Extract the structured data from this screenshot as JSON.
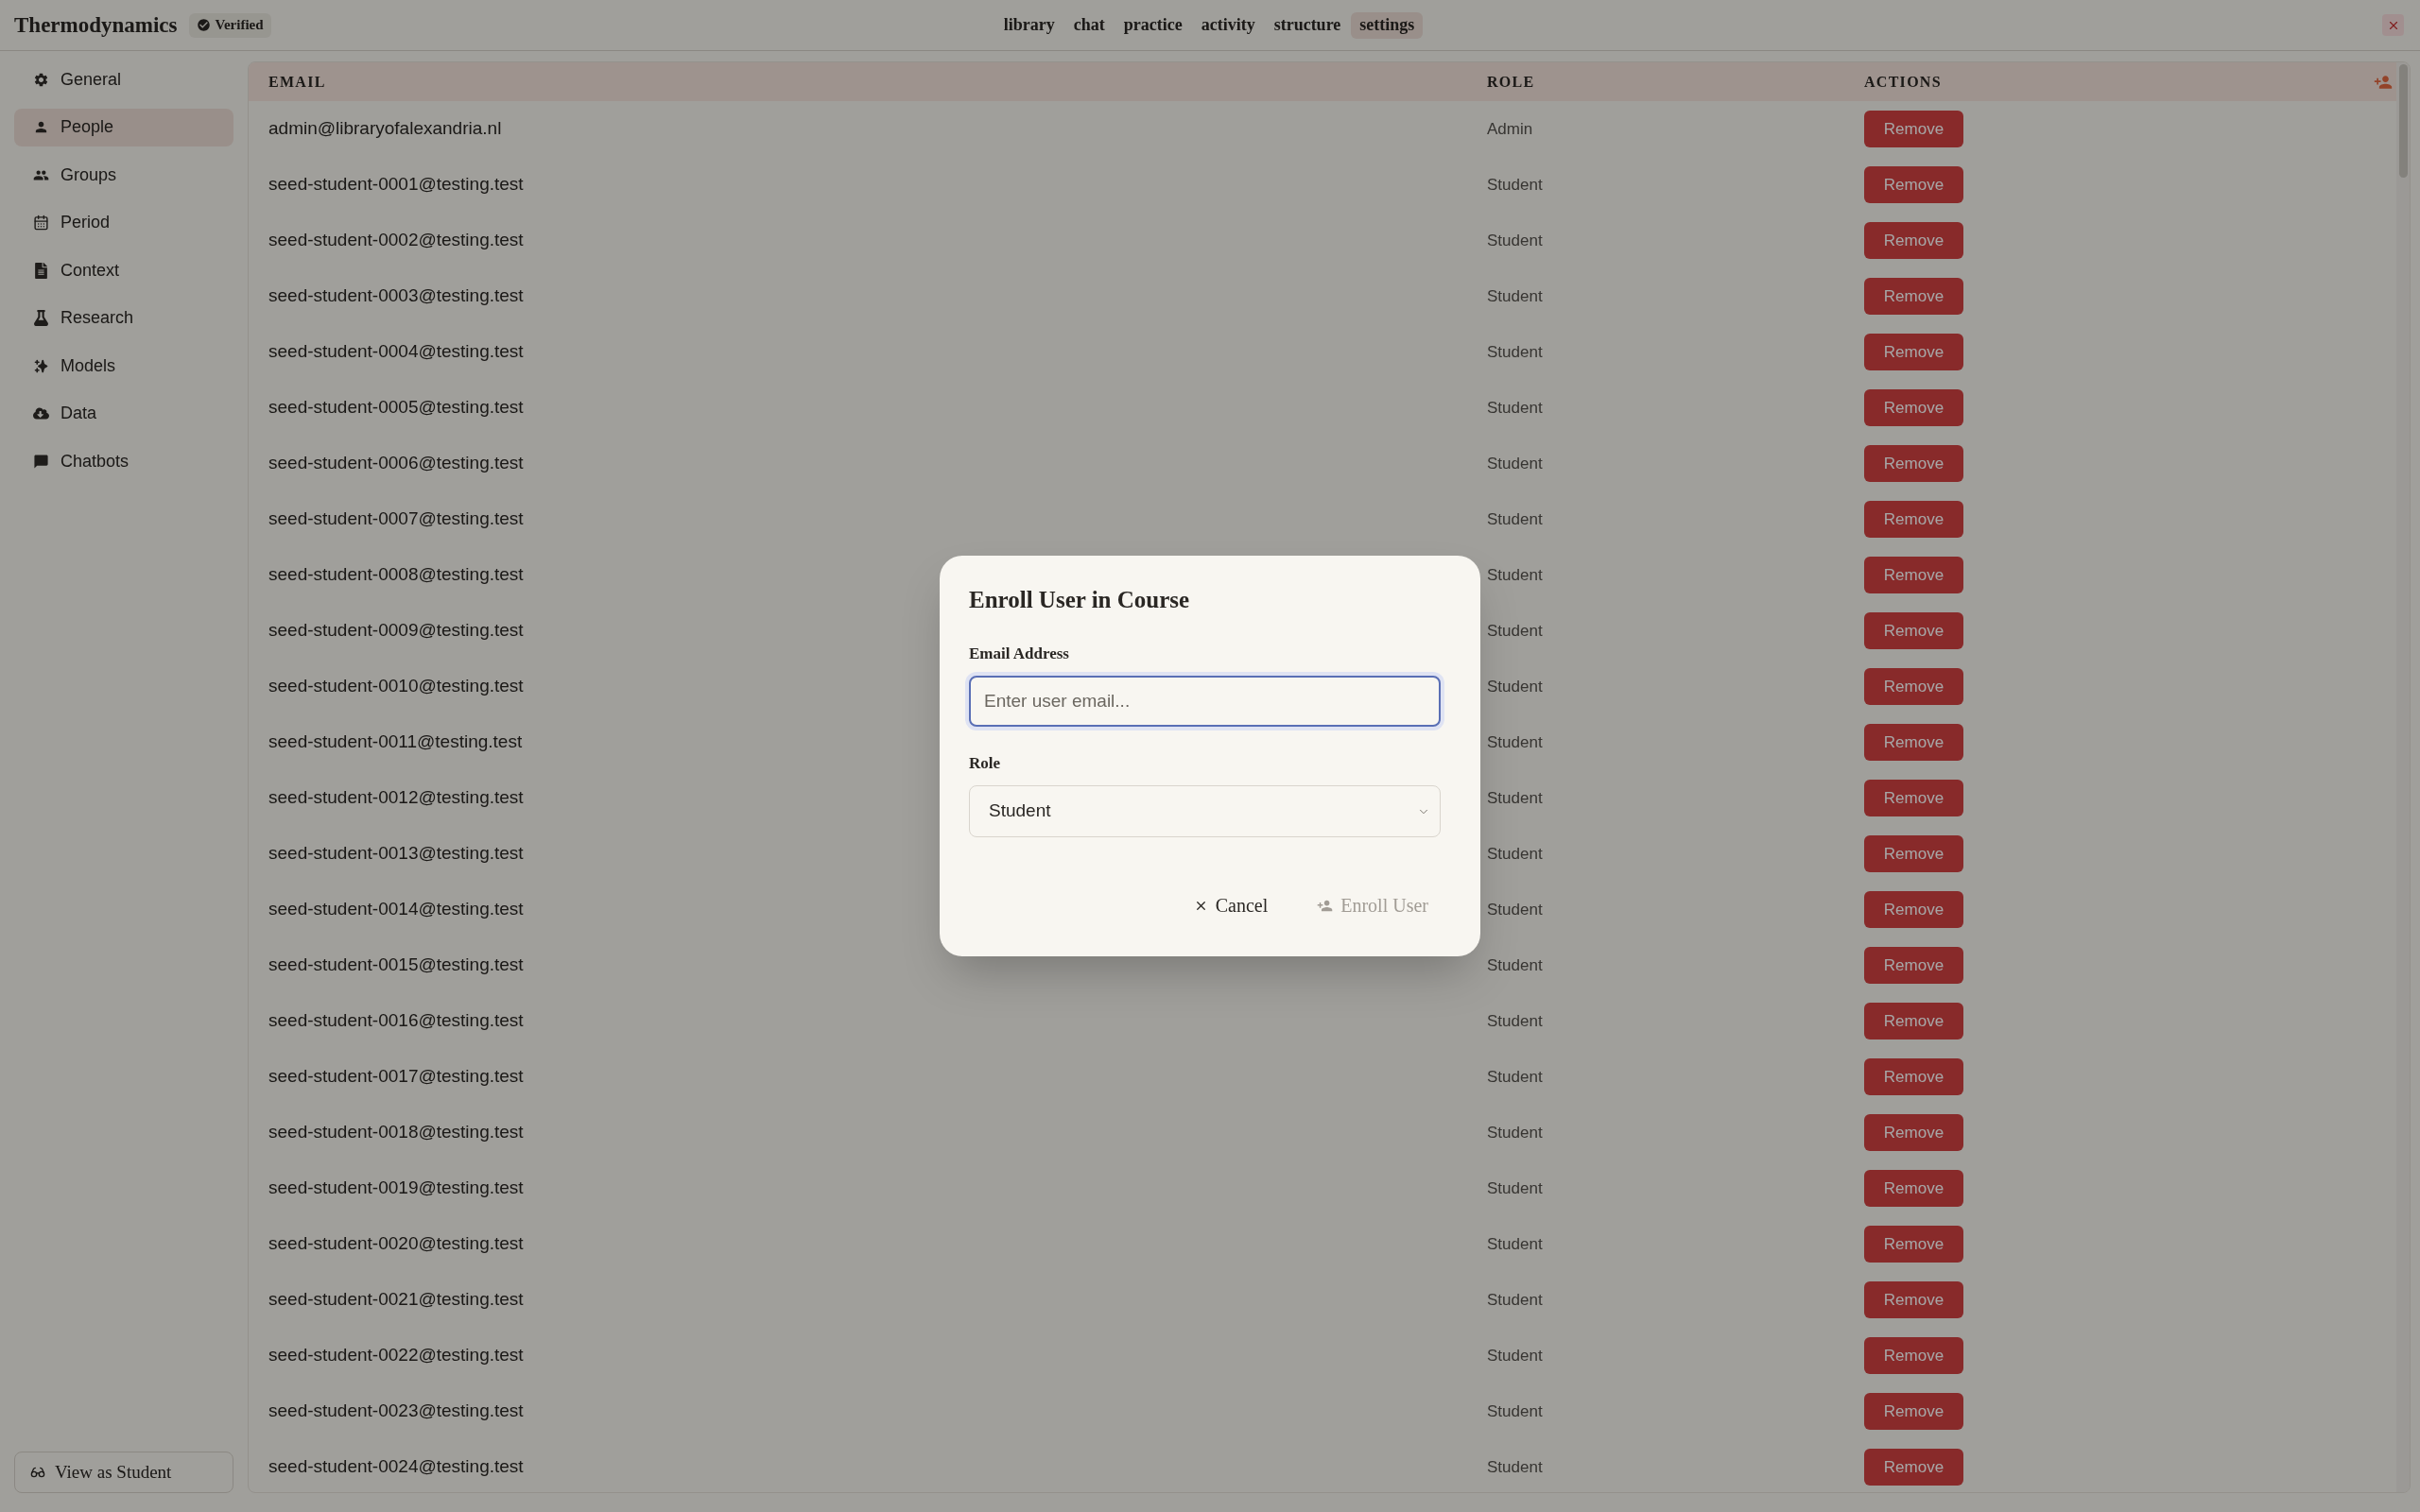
{
  "app_bar": {
    "title": "Thermodynamics",
    "badge": {
      "label": "Verified"
    },
    "nav_tabs": [
      {
        "label": "library",
        "selected": false
      },
      {
        "label": "chat",
        "selected": false
      },
      {
        "label": "practice",
        "selected": false
      },
      {
        "label": "activity",
        "selected": false
      },
      {
        "label": "structure",
        "selected": false
      },
      {
        "label": "settings",
        "selected": true
      }
    ]
  },
  "sidebar": {
    "items": [
      {
        "label": "General",
        "selected": false
      },
      {
        "label": "People",
        "selected": true
      },
      {
        "label": "Groups",
        "selected": false
      },
      {
        "label": "Period",
        "selected": false
      },
      {
        "label": "Context",
        "selected": false
      },
      {
        "label": "Research",
        "selected": false
      },
      {
        "label": "Models",
        "selected": false
      },
      {
        "label": "Data",
        "selected": false
      },
      {
        "label": "Chatbots",
        "selected": false
      }
    ],
    "footer_button": {
      "label": "View as Student"
    }
  },
  "table": {
    "columns": [
      "EMAIL",
      "ROLE",
      "ACTIONS"
    ],
    "rows": [
      {
        "email": "admin@libraryofalexandria.nl",
        "role": "Admin",
        "action": "Remove"
      },
      {
        "email": "seed-student-0001@testing.test",
        "role": "Student",
        "action": "Remove"
      },
      {
        "email": "seed-student-0002@testing.test",
        "role": "Student",
        "action": "Remove"
      },
      {
        "email": "seed-student-0003@testing.test",
        "role": "Student",
        "action": "Remove"
      },
      {
        "email": "seed-student-0004@testing.test",
        "role": "Student",
        "action": "Remove"
      },
      {
        "email": "seed-student-0005@testing.test",
        "role": "Student",
        "action": "Remove"
      },
      {
        "email": "seed-student-0006@testing.test",
        "role": "Student",
        "action": "Remove"
      },
      {
        "email": "seed-student-0007@testing.test",
        "role": "Student",
        "action": "Remove"
      },
      {
        "email": "seed-student-0008@testing.test",
        "role": "Student",
        "action": "Remove"
      },
      {
        "email": "seed-student-0009@testing.test",
        "role": "Student",
        "action": "Remove"
      },
      {
        "email": "seed-student-0010@testing.test",
        "role": "Student",
        "action": "Remove"
      },
      {
        "email": "seed-student-0011@testing.test",
        "role": "Student",
        "action": "Remove"
      },
      {
        "email": "seed-student-0012@testing.test",
        "role": "Student",
        "action": "Remove"
      },
      {
        "email": "seed-student-0013@testing.test",
        "role": "Student",
        "action": "Remove"
      },
      {
        "email": "seed-student-0014@testing.test",
        "role": "Student",
        "action": "Remove"
      },
      {
        "email": "seed-student-0015@testing.test",
        "role": "Student",
        "action": "Remove"
      },
      {
        "email": "seed-student-0016@testing.test",
        "role": "Student",
        "action": "Remove"
      },
      {
        "email": "seed-student-0017@testing.test",
        "role": "Student",
        "action": "Remove"
      },
      {
        "email": "seed-student-0018@testing.test",
        "role": "Student",
        "action": "Remove"
      },
      {
        "email": "seed-student-0019@testing.test",
        "role": "Student",
        "action": "Remove"
      },
      {
        "email": "seed-student-0020@testing.test",
        "role": "Student",
        "action": "Remove"
      },
      {
        "email": "seed-student-0021@testing.test",
        "role": "Student",
        "action": "Remove"
      },
      {
        "email": "seed-student-0022@testing.test",
        "role": "Student",
        "action": "Remove"
      },
      {
        "email": "seed-student-0023@testing.test",
        "role": "Student",
        "action": "Remove"
      },
      {
        "email": "seed-student-0024@testing.test",
        "role": "Student",
        "action": "Remove"
      }
    ]
  },
  "dialog": {
    "title": "Enroll User in Course",
    "fields": [
      {
        "kind": "text",
        "label": "Email Address",
        "placeholder": "Enter user email...",
        "focused": true
      },
      {
        "kind": "select",
        "label": "Role",
        "value": "Student"
      }
    ],
    "buttons": [
      {
        "kind": "cancel",
        "label": "Cancel",
        "disabled": false
      },
      {
        "kind": "submit",
        "label": "Enroll User",
        "disabled": true
      }
    ]
  }
}
